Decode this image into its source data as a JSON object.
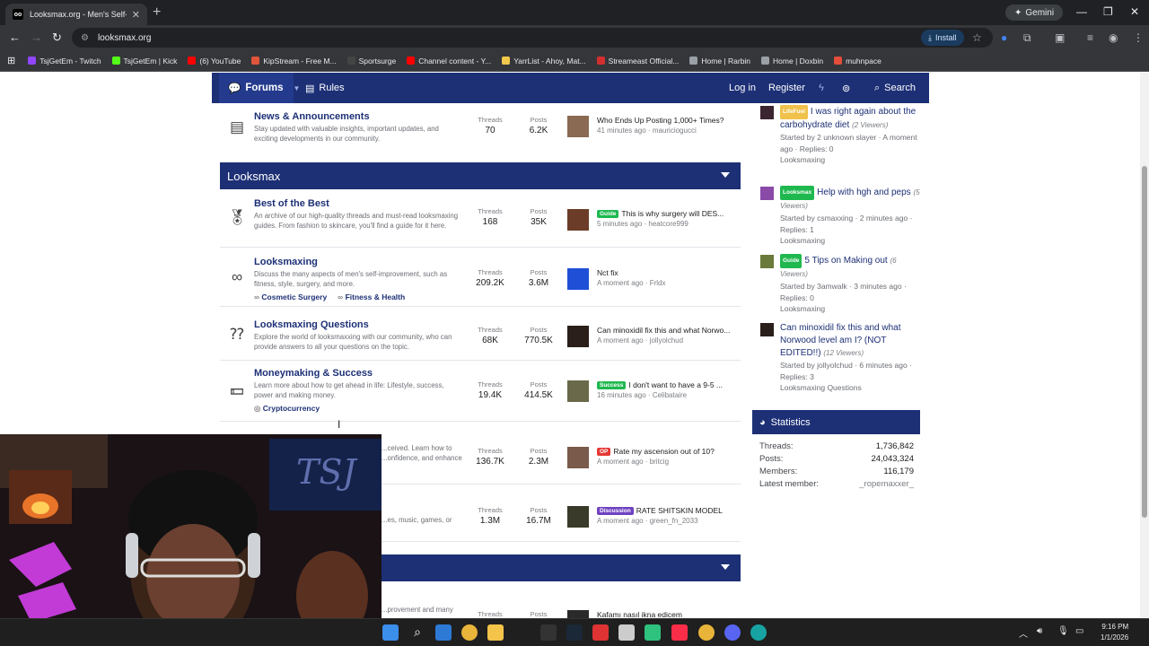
{
  "browser": {
    "tab_title": "Looksmax.org - Men's Self-Imp",
    "tab_favicon": "oo",
    "gemini_label": "Gemini",
    "url": "looksmax.org",
    "install_label": "Install",
    "bookmarks": [
      {
        "label": "TsjGetEm - Twitch",
        "color": "#9146ff"
      },
      {
        "label": "TsjGetEm | Kick",
        "color": "#53fc18"
      },
      {
        "label": "(6) YouTube",
        "color": "#ff0000"
      },
      {
        "label": "KipStream - Free M...",
        "color": "#e0553b"
      },
      {
        "label": "Sportsurge",
        "color": "#444444"
      },
      {
        "label": "Channel content - Y...",
        "color": "#ff0000"
      },
      {
        "label": "YarrList - Ahoy, Mat...",
        "color": "#f2c94c"
      },
      {
        "label": "Streameast Official...",
        "color": "#d32f2f"
      },
      {
        "label": "Home | Rarbin",
        "color": "#9aa0a6"
      },
      {
        "label": "Home | Doxbin",
        "color": "#9aa0a6"
      },
      {
        "label": "muhnpace",
        "color": "#e44d3a"
      }
    ]
  },
  "site": {
    "nav": {
      "forums": "Forums",
      "rules": "Rules",
      "login": "Log in",
      "register": "Register",
      "search": "Search"
    },
    "news": {
      "title": "News & Announcements",
      "desc": "Stay updated with valuable insights, important updates, and exciting developments in our community.",
      "threads_label": "Threads",
      "threads": "70",
      "posts_label": "Posts",
      "posts": "6.2K",
      "last_title": "Who Ends Up Posting 1,000+ Times?",
      "last_meta": "41 minutes ago · mauriciogucci"
    },
    "category": "Looksmax",
    "forums": [
      {
        "title": "Best of the Best",
        "desc": "An archive of our high-quality threads and must-read looksmaxing guides. From fashion to skincare, you'll find a guide for it here.",
        "threads": "168",
        "posts": "35K",
        "prefix": "Guide",
        "prefix_color": "#1fb84f",
        "last_title": "This is why surgery will DES...",
        "last_meta": "5 minutes ago · heatcore999"
      },
      {
        "title": "Looksmaxing",
        "desc": "Discuss the many aspects of men's self-improvement, such as fitness, style, surgery, and more.",
        "subforums": [
          "Cosmetic Surgery",
          "Fitness & Health"
        ],
        "threads": "209.2K",
        "posts": "3.6M",
        "last_title": "Nct fix",
        "last_meta": "A moment ago · Frldx"
      },
      {
        "title": "Looksmaxing Questions",
        "desc": "Explore the world of looksmaxxing with our community, who can provide answers to all your questions on the topic.",
        "threads": "68K",
        "posts": "770.5K",
        "last_title": "Can minoxidil fix this and what Norwo...",
        "last_meta": "A moment ago · jollyolchud"
      },
      {
        "title": "Moneymaking & Success",
        "desc": "Learn more about how to get ahead in life: Lifestyle, success, power and making money.",
        "subforums": [
          "Cryptocurrency"
        ],
        "threads": "19.4K",
        "posts": "414.5K",
        "prefix": "Success",
        "prefix_color": "#1fb84f",
        "last_title": "I don't want to have a 9-5 ...",
        "last_meta": "16 minutes ago · Celibataire"
      },
      {
        "title": "",
        "desc": "...ceived. Learn how to ...onfidence, and enhance",
        "threads": "136.7K",
        "posts": "2.3M",
        "prefix": "OP",
        "prefix_color": "#e53935",
        "last_title": "Rate my ascension out of 10?",
        "last_meta": "A moment ago · britcig"
      },
      {
        "title": "",
        "desc": "...es, music, games, or",
        "threads": "1.3M",
        "posts": "16.7M",
        "prefix": "Discussion",
        "prefix_color": "#6f42c1",
        "last_title": "RATE SHITSKIN MODEL",
        "last_meta": "A moment ago · green_fn_2033"
      }
    ],
    "bottom_row": {
      "desc": "...provement and many",
      "threads_label": "Threads",
      "posts_label": "Posts",
      "last_title": "Kafamı nasıl ikna edicem"
    },
    "sidebar": {
      "threads": [
        {
          "prefix": "LifeFuel",
          "prefix_color": "#f0c14b",
          "title": "I was right again about the carbohydrate diet",
          "viewers": "(2 Viewers)",
          "meta": "Started by 2 unknown slayer · A moment ago · Replies: 0",
          "forum": "Looksmaxing"
        },
        {
          "prefix": "Looksmax",
          "prefix_color": "#1fb84f",
          "title": "Help with hgh and peps",
          "viewers": "(5 Viewers)",
          "meta": "Started by csmaxxing · 2 minutes ago · Replies: 1",
          "forum": "Looksmaxing"
        },
        {
          "prefix": "Guide",
          "prefix_color": "#1fb84f",
          "title": "5 Tips on Making out",
          "viewers": "(6 Viewers)",
          "meta": "Started by 3amwalk · 3 minutes ago · Replies: 0",
          "forum": "Looksmaxing"
        },
        {
          "prefix": "",
          "title": "Can minoxidil fix this and what Norwood level am I? (NOT EDITED!!)",
          "viewers": "(12 Viewers)",
          "meta": "Started by jollyolchud · 6 minutes ago · Replies: 3",
          "forum": "Looksmaxing Questions"
        }
      ],
      "stats_title": "Statistics",
      "stats": [
        {
          "label": "Threads:",
          "value": "1,736,842"
        },
        {
          "label": "Posts:",
          "value": "24,043,324"
        },
        {
          "label": "Members:",
          "value": "116,179"
        },
        {
          "label": "Latest member:",
          "value": "_ropemaxxer_"
        }
      ]
    }
  },
  "taskbar": {
    "time": "9:16 PM",
    "date": "1/1/2026"
  }
}
